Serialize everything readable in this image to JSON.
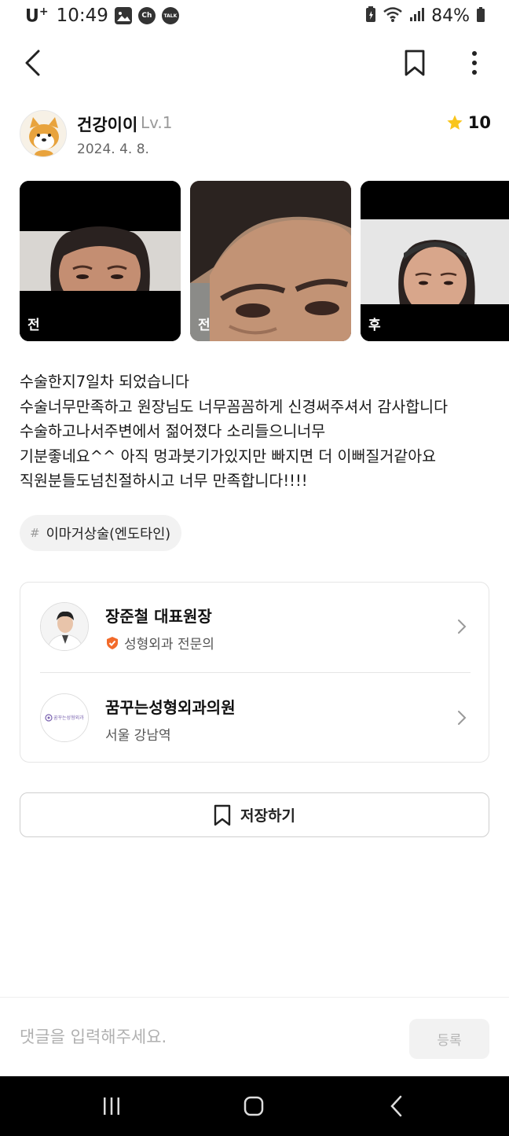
{
  "status_bar": {
    "carrier": "U",
    "carrier_sup": "+",
    "time": "10:49",
    "notif_icons": [
      "image-icon",
      "ch-icon",
      "talk-icon"
    ],
    "ch_label": "Ch",
    "talk_label": "TALK",
    "battery": "84%"
  },
  "author": {
    "name": "건강이이",
    "level": "Lv.1",
    "date": "2024. 4. 8.",
    "rating": "10"
  },
  "photos": [
    {
      "label": "전"
    },
    {
      "label": "전"
    },
    {
      "label": "후"
    }
  ],
  "post": {
    "lines": [
      "수술한지7일차 되었습니다",
      "수술너무만족하고 원장님도 너무꼼꼼하게 신경써주셔서 감사합니다",
      "수술하고나서주변에서 젊어졌다 소리들으니너무",
      "기분좋네요^^ 아직 멍과붓기가있지만 빠지면 더 이뻐질거같아요",
      "직원분들도넘친절하시고 너무 만족합니다!!!!"
    ]
  },
  "tag": {
    "hash": "#",
    "label": "이마거상술(엔도타인)"
  },
  "doctor": {
    "name": "장준철 대표원장",
    "specialty": "성형외과 전문의"
  },
  "clinic": {
    "name": "꿈꾸는성형외과의원",
    "location": "서울 강남역",
    "logo_text": "꿈꾸는성형외과"
  },
  "save_button": {
    "label": "저장하기"
  },
  "comment": {
    "placeholder": "댓글을 입력해주세요.",
    "submit_label": "등록"
  },
  "colors": {
    "star": "#f9c51c",
    "badge": "#f26a2a",
    "nav_bar": "#000000",
    "disabled_text": "#b5b5b5"
  }
}
